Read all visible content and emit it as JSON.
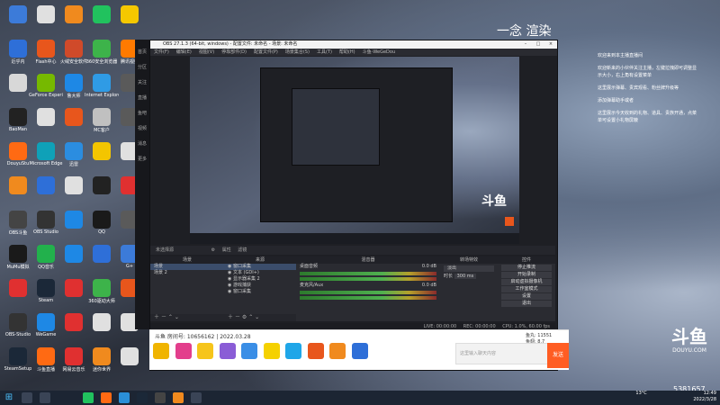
{
  "desktop": {
    "icons": [
      {
        "label": "",
        "col": 0,
        "row": 0,
        "color": "#3c7bd9"
      },
      {
        "label": "",
        "col": 1,
        "row": 0,
        "color": "#e0e0e0"
      },
      {
        "label": "",
        "col": 2,
        "row": 0,
        "color": "#f08a1e"
      },
      {
        "label": "",
        "col": 3,
        "row": 0,
        "color": "#21c25e"
      },
      {
        "label": "",
        "col": 4,
        "row": 0,
        "color": "#f5c800"
      },
      {
        "label": "近乎内",
        "col": 0,
        "row": 1,
        "color": "#2e6fd8"
      },
      {
        "label": "Flash中心",
        "col": 1,
        "row": 1,
        "color": "#e8561c"
      },
      {
        "label": "火绒安全软件",
        "col": 2,
        "row": 1,
        "color": "#d04a2a"
      },
      {
        "label": "360安全浏览器",
        "col": 3,
        "row": 1,
        "color": "#3db34a"
      },
      {
        "label": "腾讯视频",
        "col": 4,
        "row": 1,
        "color": "#ff7a00"
      },
      {
        "label": "",
        "col": 0,
        "row": 2,
        "color": "#d8d8d8"
      },
      {
        "label": "GeForce Experience",
        "col": 1,
        "row": 2,
        "color": "#76b900"
      },
      {
        "label": "鲁大师",
        "col": 2,
        "row": 2,
        "color": "#1e88e5"
      },
      {
        "label": "Internet Explorer",
        "col": 3,
        "row": 2,
        "color": "#2f9be5"
      },
      {
        "label": "",
        "col": 4,
        "row": 2,
        "color": "#5a5a5a"
      },
      {
        "label": "BaoMan",
        "col": 0,
        "row": 3,
        "color": "#222"
      },
      {
        "label": "",
        "col": 1,
        "row": 3,
        "color": "#e0e0e0"
      },
      {
        "label": "",
        "col": 2,
        "row": 3,
        "color": "#e8561c"
      },
      {
        "label": "MC客户",
        "col": 3,
        "row": 3,
        "color": "#c0c0c0"
      },
      {
        "label": "",
        "col": 4,
        "row": 3,
        "color": "#5a5a5a"
      },
      {
        "label": "DouyuStu",
        "col": 0,
        "row": 4,
        "color": "#ff6a13"
      },
      {
        "label": "Microsoft Edge",
        "col": 1,
        "row": 4,
        "color": "#0fa1b8"
      },
      {
        "label": "迅雷",
        "col": 2,
        "row": 4,
        "color": "#2b8de0"
      },
      {
        "label": "",
        "col": 3,
        "row": 4,
        "color": "#f3c500"
      },
      {
        "label": "",
        "col": 4,
        "row": 4,
        "color": "#e0e0e0"
      },
      {
        "label": "",
        "col": 0,
        "row": 5,
        "color": "#f08a1e"
      },
      {
        "label": "",
        "col": 1,
        "row": 5,
        "color": "#2e6fd8"
      },
      {
        "label": "",
        "col": 2,
        "row": 5,
        "color": "#e0e0e0"
      },
      {
        "label": "",
        "col": 3,
        "row": 5,
        "color": "#222"
      },
      {
        "label": "",
        "col": 4,
        "row": 5,
        "color": "#e03030"
      },
      {
        "label": "OBS斗鱼",
        "col": 0,
        "row": 6,
        "color": "#444"
      },
      {
        "label": "OBS Studio",
        "col": 1,
        "row": 6,
        "color": "#333"
      },
      {
        "label": "",
        "col": 2,
        "row": 6,
        "color": "#1e88e5"
      },
      {
        "label": "QQ",
        "col": 3,
        "row": 6,
        "color": "#1a1a1a"
      },
      {
        "label": "",
        "col": 4,
        "row": 6,
        "color": "#5a5a5a"
      },
      {
        "label": "MuMu模拟",
        "col": 0,
        "row": 7,
        "color": "#1a1a1a"
      },
      {
        "label": "QQ音乐",
        "col": 1,
        "row": 7,
        "color": "#22b14c"
      },
      {
        "label": "",
        "col": 2,
        "row": 7,
        "color": "#1e88e5"
      },
      {
        "label": "",
        "col": 3,
        "row": 7,
        "color": "#2e6fd8"
      },
      {
        "label": "G+",
        "col": 4,
        "row": 7,
        "color": "#3c7bd9"
      },
      {
        "label": "",
        "col": 0,
        "row": 8,
        "color": "#e03030"
      },
      {
        "label": "Steam",
        "col": 1,
        "row": 8,
        "color": "#1b2838"
      },
      {
        "label": "",
        "col": 2,
        "row": 8,
        "color": "#e03030"
      },
      {
        "label": "360驱动大师",
        "col": 3,
        "row": 8,
        "color": "#3db34a"
      },
      {
        "label": "",
        "col": 4,
        "row": 8,
        "color": "#e8561c"
      },
      {
        "label": "OBS-Studio",
        "col": 0,
        "row": 9,
        "color": "#333"
      },
      {
        "label": "WeGame",
        "col": 1,
        "row": 9,
        "color": "#1e88e5"
      },
      {
        "label": "",
        "col": 2,
        "row": 9,
        "color": "#e03030"
      },
      {
        "label": "",
        "col": 3,
        "row": 9,
        "color": "#e0e0e0"
      },
      {
        "label": "",
        "col": 4,
        "row": 9,
        "color": "#e0e0e0"
      },
      {
        "label": "SteamSetup",
        "col": 0,
        "row": 10,
        "color": "#1b2838"
      },
      {
        "label": "斗鱼直播",
        "col": 1,
        "row": 10,
        "color": "#ff6a13"
      },
      {
        "label": "网易云音乐",
        "col": 2,
        "row": 10,
        "color": "#e03030"
      },
      {
        "label": "迷你世界",
        "col": 3,
        "row": 10,
        "color": "#f08a1e"
      },
      {
        "label": "",
        "col": 4,
        "row": 10,
        "color": "#e0e0e0"
      }
    ]
  },
  "obs": {
    "title": "OBS 27.1.3 (64-bit, windows) - 配置文件: 未命名 - 场景: 未命名",
    "menu": [
      "文件(F)",
      "编辑(E)",
      "视图(V)",
      "停靠部件(D)",
      "配置文件(P)",
      "场景集合(S)",
      "工具(T)",
      "帮助(H)",
      "斗鱼-WeGeDou"
    ],
    "context_bar": {
      "source": "未选择源",
      "props": "属性",
      "filter": "滤镜"
    },
    "scenes": {
      "header": "场景",
      "items": [
        "场景",
        "场景 2"
      ]
    },
    "sources": {
      "header": "来源",
      "items": [
        "窗口采集",
        "文本 (GDI+)",
        "显示器采集 2",
        "游戏捕获",
        "窗口采集"
      ]
    },
    "mixer": {
      "header": "混音器",
      "channels": [
        {
          "name": "桌面音频",
          "db": "0.0 dB"
        },
        {
          "name": "麦克风/Aux",
          "db": "0.0 dB"
        }
      ]
    },
    "transitions": {
      "header": "转场特效",
      "type": "淡出",
      "duration_label": "时长",
      "duration": "300 ms"
    },
    "controls": {
      "header": "控件",
      "buttons": [
        "停止推流",
        "开始录制",
        "启动虚拟摄像机",
        "工作室模式",
        "设置",
        "退出"
      ]
    },
    "status": {
      "live": "LIVE: 00:00:00",
      "rec": "REC: 00:00:00",
      "cpu": "CPU: 1.0%, 60.00 fps"
    }
  },
  "sidebar": {
    "items": [
      "首页",
      "分区",
      "关注",
      "直播",
      "鱼吧",
      "视频",
      "消息",
      "更多"
    ]
  },
  "douyu": {
    "room_info": "斗鱼 房间号: 10656162 | 2022.03.28",
    "chat_placeholder": "这里输入聊天内容",
    "send": "发送",
    "stats_1": "鱼丸: 11551",
    "stats_2": "鱼翅: 8.7"
  },
  "overlay": {
    "watermark": "一念 渲染",
    "notes": [
      "欢迎来到本主播直播间",
      "欢迎新来的小伙伴关注主播，左键拉拽即可调整显示大小，右上角有设置菜单",
      "这里展示弹幕、贵宾观看、粉丝牌升级等",
      "添加弹幕助手或者",
      "这里展示今天收到的礼物、道具、贵族开通，点菜单可设置小礼物屏蔽"
    ]
  },
  "douyu_logo": {
    "mark": "斗鱼",
    "domain": "DOUYU.COM"
  },
  "taskbar": {
    "start_icon": "windows-logo",
    "weather": "13°C",
    "time": "12:49",
    "date": "2022/3/28",
    "counter": "5381657"
  }
}
